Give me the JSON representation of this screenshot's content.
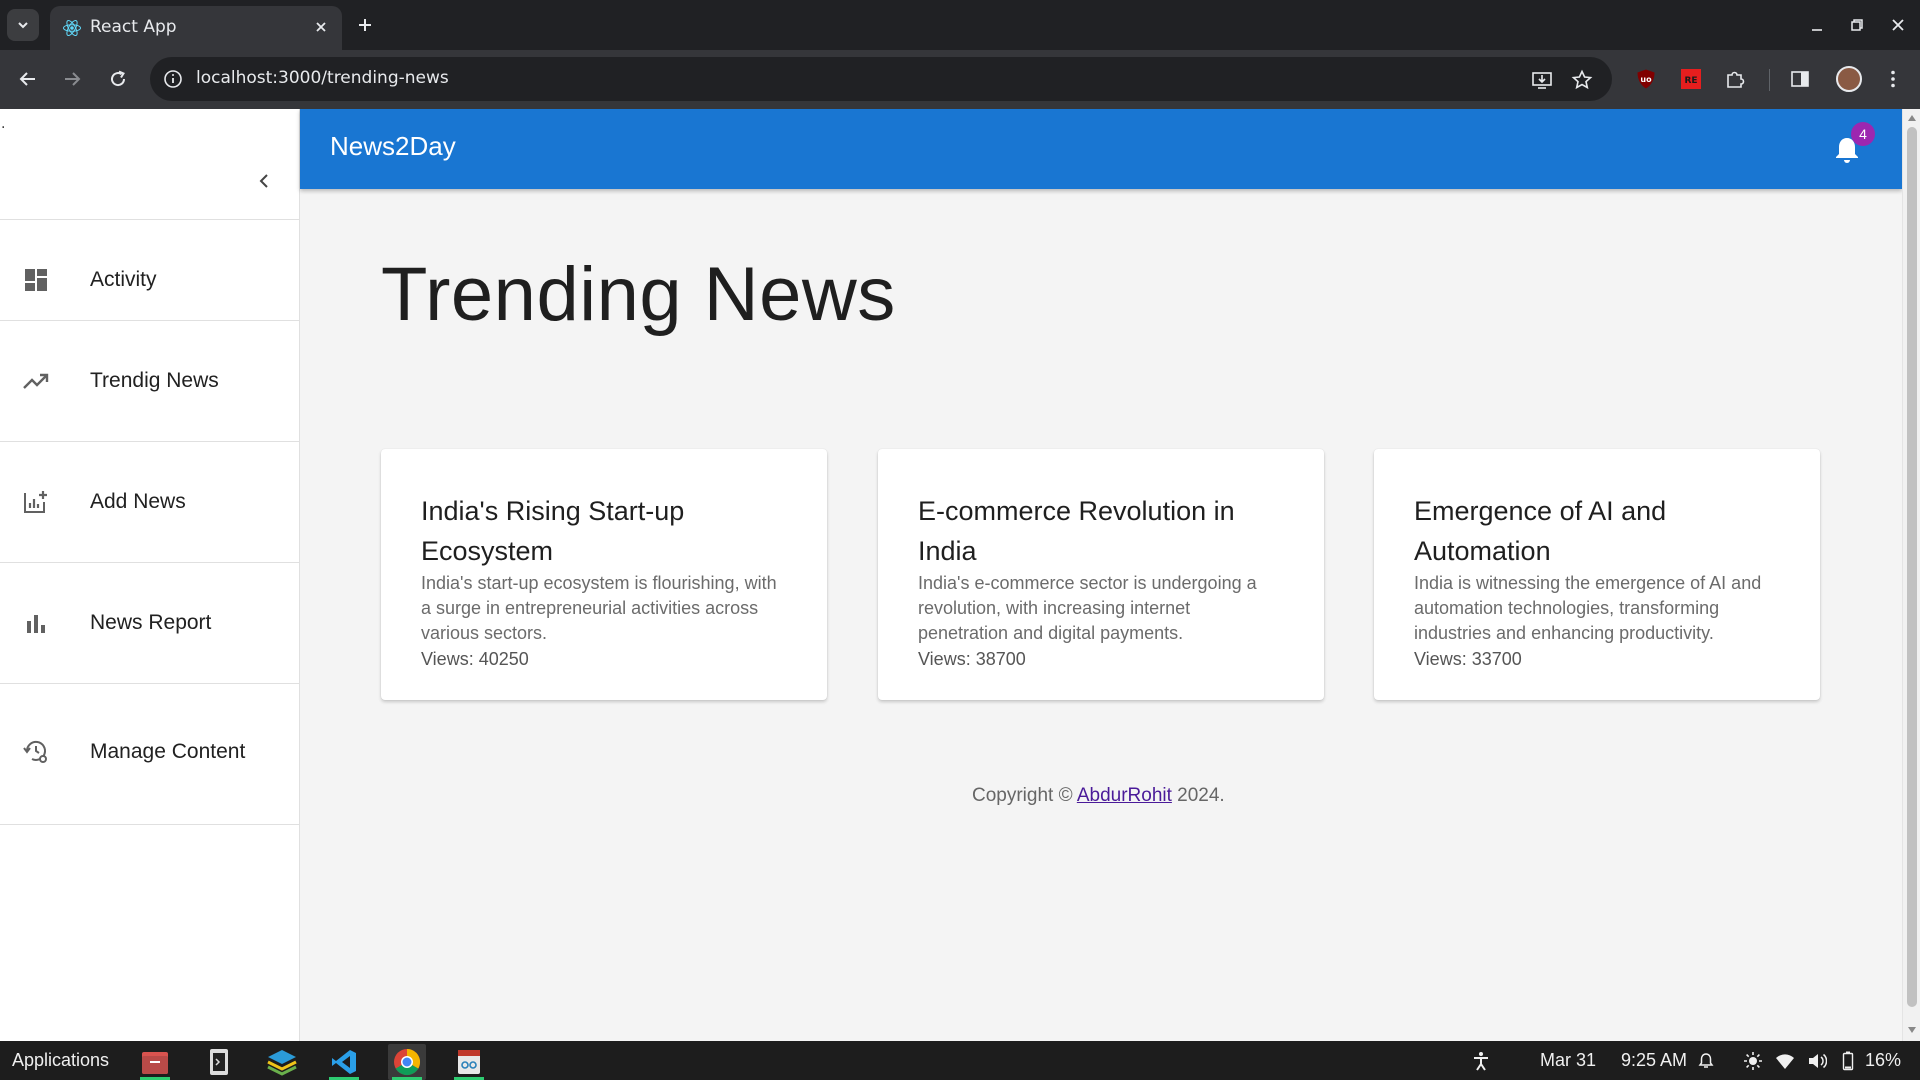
{
  "browser": {
    "tab_title": "React App",
    "url": "localhost:3000/trending-news"
  },
  "app": {
    "brand": "News2Day",
    "notification_count": "4",
    "page_title": "Trending News",
    "sidebar_marker": ".",
    "sidebar": {
      "items": [
        {
          "label": "Activity",
          "icon": "dashboard-icon"
        },
        {
          "label": "Trendig News",
          "icon": "trending-up-icon"
        },
        {
          "label": "Add News",
          "icon": "add-chart-icon"
        },
        {
          "label": "News Report",
          "icon": "bar-chart-icon"
        },
        {
          "label": "Manage Content",
          "icon": "manage-history-icon"
        }
      ]
    },
    "cards": [
      {
        "title": "India's Rising Start-up Ecosystem",
        "description": "India's start-up ecosystem is flourishing, with a surge in entrepreneurial activities across various sectors.",
        "views": "Views: 40250"
      },
      {
        "title": "E-commerce Revolution in India",
        "description": "India's e-commerce sector is undergoing a revolution, with increasing internet penetration and digital payments.",
        "views": "Views: 38700"
      },
      {
        "title": "Emergence of AI and Automation",
        "description": "India is witnessing the emergence of AI and automation technologies, transforming industries and enhancing productivity.",
        "views": "Views: 33700"
      }
    ],
    "footer": {
      "prefix": "Copyright © ",
      "author": "AbdurRohit",
      "suffix": " 2024."
    }
  },
  "taskbar": {
    "applications_label": "Applications",
    "date": "Mar 31",
    "time": "9:25 AM",
    "battery": "16%"
  },
  "colors": {
    "appbar": "#1976d2",
    "badge": "#9c27b0",
    "link": "#4a1a99"
  }
}
